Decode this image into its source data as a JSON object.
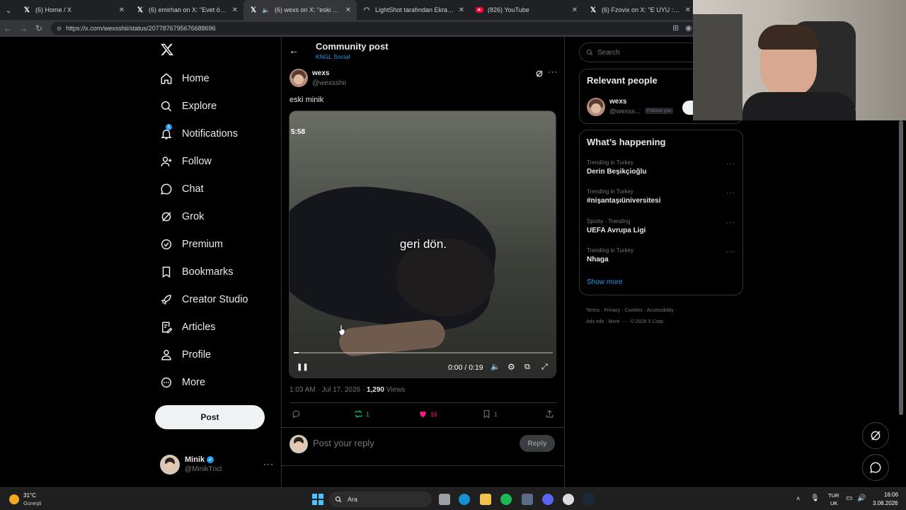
{
  "browser": {
    "tabs": [
      {
        "title": "(6) Home / X",
        "icon": "x-logo-icon"
      },
      {
        "title": "(6) emirhan on X: \"Evet öncelikle y",
        "icon": "x-logo-icon"
      },
      {
        "title": "(6) wexs on X: \"eski minik http",
        "icon": "x-logo-icon",
        "active": true
      },
      {
        "title": "LightShot tarafından Ekran Görünt",
        "icon": "lightshot-icon"
      },
      {
        "title": "(826) YouTube",
        "icon": "youtube-icon"
      },
      {
        "title": "(6) Fzovix on X: \"E UYU :) https://t.",
        "icon": "x-logo-icon"
      }
    ],
    "url": "https://x.com/wexsshii/status/2077876795676688696"
  },
  "sidebar": {
    "items": [
      {
        "label": "Home",
        "icon": "home-icon"
      },
      {
        "label": "Explore",
        "icon": "search-icon"
      },
      {
        "label": "Notifications",
        "icon": "bell-icon",
        "badge": "5"
      },
      {
        "label": "Follow",
        "icon": "follow-icon"
      },
      {
        "label": "Chat",
        "icon": "chat-icon"
      },
      {
        "label": "Grok",
        "icon": "grok-icon"
      },
      {
        "label": "Premium",
        "icon": "premium-icon"
      },
      {
        "label": "Bookmarks",
        "icon": "bookmark-icon"
      },
      {
        "label": "Creator Studio",
        "icon": "rocket-icon"
      },
      {
        "label": "Articles",
        "icon": "articles-icon"
      },
      {
        "label": "Profile",
        "icon": "profile-icon"
      },
      {
        "label": "More",
        "icon": "more-circle-icon"
      }
    ],
    "post_label": "Post",
    "account": {
      "name": "Minik",
      "handle": "@MinikTncl"
    }
  },
  "header": {
    "title": "Community post",
    "subtitle": "KNGL Social"
  },
  "post": {
    "author": "wexs",
    "handle": "@wexsshii",
    "text": "eski minik",
    "video": {
      "overlay_time": "5:58",
      "caption": "geri dön.",
      "time_display": "0:00 / 0:19",
      "progress": 0.02
    },
    "timestamp": "1:03 AM · Jul 17, 2026 · ",
    "views_count": "1,290",
    "views_label": "Views",
    "replies": "",
    "reposts": "1",
    "likes": "16",
    "bookmarks": "1",
    "reply_placeholder": "Post your reply",
    "reply_button": "Reply"
  },
  "right": {
    "search_placeholder": "Search",
    "relevant": {
      "title": "Relevant people",
      "name": "wexs",
      "handle": "@wexss...",
      "follows_you": "Follows you"
    },
    "happening": {
      "title": "What’s happening",
      "trends": [
        {
          "category": "Trending in Turkey",
          "name": "Derin Beşikçioğlu"
        },
        {
          "category": "Trending in Turkey",
          "name": "#nişantaşıüniversitesi"
        },
        {
          "category": "Sports · Trending",
          "name": "UEFA Avrupa Ligi"
        },
        {
          "category": "Trending in Turkey",
          "name": "Nhaga"
        }
      ],
      "show_more": "Show more"
    },
    "footer": {
      "links": [
        "Terms",
        "Privacy",
        "Cookies",
        "Accessibility",
        "Ads info",
        "More ···"
      ],
      "copyright": "© 2026 X Corp."
    }
  },
  "taskbar": {
    "weather_temp": "31°C",
    "weather_text": "Güneşli",
    "search_label": "Ara",
    "lang": "TUR",
    "lang2": "UK",
    "time": "16:06",
    "date": "3.08.2026"
  },
  "colors": {
    "accent": "#1d9bf0",
    "like": "#f91880",
    "repost": "#00ba7c"
  }
}
